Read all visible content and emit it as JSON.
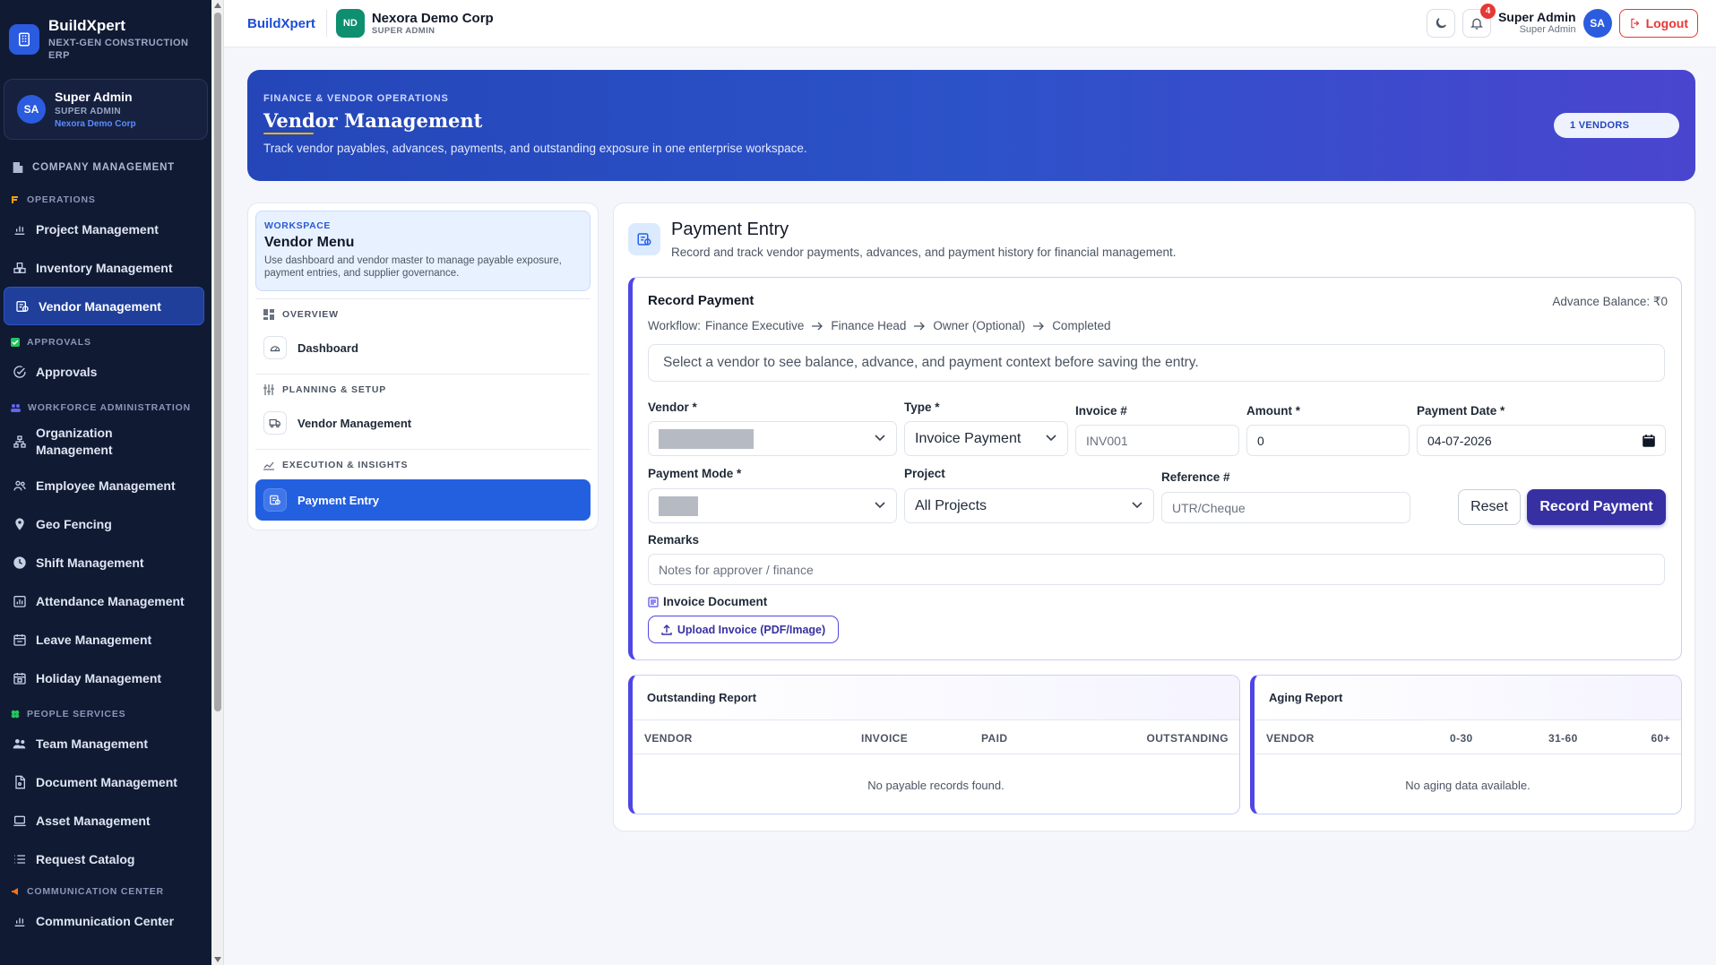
{
  "sidebar": {
    "brand": {
      "name": "BuildXpert",
      "tagline": "NEXT-GEN CONSTRUCTION ERP"
    },
    "user": {
      "initials": "SA",
      "name": "Super Admin",
      "role": "SUPER ADMIN",
      "org": "Nexora Demo Corp"
    },
    "company_management": "COMPANY MANAGEMENT",
    "sections": {
      "operations": "OPERATIONS",
      "approvals": "APPROVALS",
      "workforce": "WORKFORCE ADMINISTRATION",
      "people": "PEOPLE SERVICES",
      "communication": "COMMUNICATION CENTER"
    },
    "items": {
      "project": "Project Management",
      "inventory": "Inventory Management",
      "vendor": "Vendor Management",
      "approvals": "Approvals",
      "organization": "Organization Management",
      "employee": "Employee Management",
      "geo": "Geo Fencing",
      "shift": "Shift Management",
      "attendance": "Attendance Management",
      "leave": "Leave Management",
      "holiday": "Holiday Management",
      "team": "Team Management",
      "document": "Document Management",
      "asset": "Asset Management",
      "request": "Request Catalog",
      "communication": "Communication Center"
    }
  },
  "topbar": {
    "brand": "BuildXpert",
    "org_initials": "ND",
    "org_name": "Nexora Demo Corp",
    "org_role": "SUPER ADMIN",
    "notifications": "4",
    "user_name": "Super Admin",
    "user_role": "Super Admin",
    "user_initials": "SA",
    "logout": "Logout"
  },
  "hero": {
    "eyebrow": "FINANCE & VENDOR OPERATIONS",
    "title": "Vendor Management",
    "subtitle": "Track vendor payables, advances, payments, and outstanding exposure in one enterprise workspace.",
    "pill": "1 VENDORS"
  },
  "vendor_menu": {
    "eyebrow": "WORKSPACE",
    "title": "Vendor Menu",
    "description": "Use dashboard and vendor master to manage payable exposure, payment entries, and supplier governance.",
    "sections": {
      "overview": "OVERVIEW",
      "planning": "PLANNING & SETUP",
      "execution": "EXECUTION & INSIGHTS"
    },
    "items": {
      "dashboard": "Dashboard",
      "vendor": "Vendor Management",
      "payment": "Payment Entry"
    }
  },
  "payment_entry": {
    "title": "Payment Entry",
    "subtitle": "Record and track vendor payments, advances, and payment history for financial management.",
    "record_title": "Record Payment",
    "advance_balance": "Advance Balance: ₹0",
    "workflow": {
      "prefix": "Workflow:",
      "steps": [
        "Finance Executive",
        "Finance Head",
        "Owner (Optional)",
        "Completed"
      ]
    },
    "hint": "Select a vendor to see balance, advance, and payment context before saving the entry.",
    "labels": {
      "vendor": "Vendor *",
      "type": "Type *",
      "invoice": "Invoice #",
      "amount": "Amount *",
      "payment_date": "Payment Date *",
      "payment_mode": "Payment Mode *",
      "project": "Project",
      "reference": "Reference #",
      "remarks": "Remarks",
      "invoice_document": "Invoice Document"
    },
    "values": {
      "type": "Invoice Payment",
      "amount": "0",
      "payment_date": "04-07-2026",
      "project": "All Projects"
    },
    "placeholders": {
      "invoice": "INV001",
      "reference": "UTR/Cheque",
      "remarks": "Notes for approver / finance"
    },
    "buttons": {
      "reset": "Reset",
      "record": "Record Payment",
      "upload": "Upload Invoice (PDF/Image)"
    }
  },
  "outstanding_report": {
    "title": "Outstanding Report",
    "columns": [
      "VENDOR",
      "INVOICE",
      "PAID",
      "OUTSTANDING"
    ],
    "empty": "No payable records found."
  },
  "aging_report": {
    "title": "Aging Report",
    "columns": [
      "VENDOR",
      "0-30",
      "31-60",
      "60+"
    ],
    "empty": "No aging data available."
  }
}
